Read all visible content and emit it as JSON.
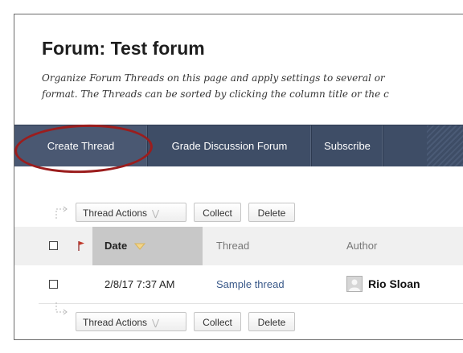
{
  "page": {
    "title": "Forum: Test forum",
    "description_lines": [
      "Organize Forum Threads on this page and apply settings to several or",
      "format. The Threads can be sorted by clicking the column title or the c"
    ]
  },
  "action_bar": {
    "create_label": "Create Thread",
    "grade_label": "Grade Discussion Forum",
    "subscribe_label": "Subscribe"
  },
  "toolbar": {
    "thread_actions_label": "Thread Actions",
    "collect_label": "Collect",
    "delete_label": "Delete"
  },
  "grid": {
    "columns": {
      "date": "Date",
      "thread": "Thread",
      "author": "Author"
    },
    "sorted_column": "Date",
    "rows": [
      {
        "date": "2/8/17 7:37 AM",
        "thread": "Sample thread",
        "author": "Rio Sloan"
      }
    ]
  },
  "colors": {
    "action_bar": "#3e4d66",
    "highlight_ellipse": "#9b1d1d",
    "link": "#3b5a8a"
  },
  "icons": [
    "flag-icon",
    "sort-descending-icon",
    "chevron-down-icon",
    "corner-arrow-icon",
    "avatar-placeholder-icon"
  ]
}
